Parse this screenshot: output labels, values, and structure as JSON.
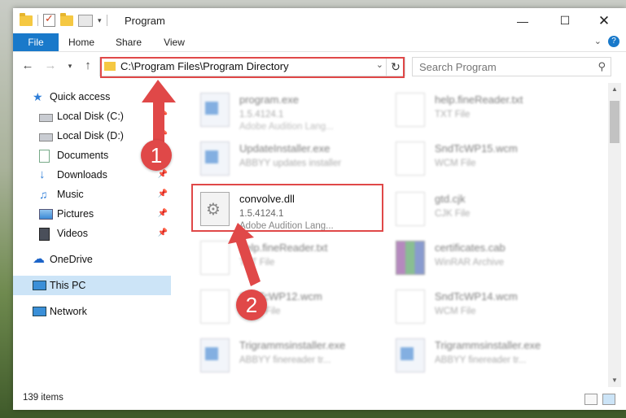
{
  "window": {
    "title": "Program"
  },
  "ribbon": {
    "tabs": [
      "File",
      "Home",
      "Share",
      "View"
    ]
  },
  "nav": {
    "address": "C:\\Program Files\\Program Directory",
    "search_placeholder": "Search Program"
  },
  "sidebar": {
    "items": [
      {
        "label": "Quick access",
        "icon": "star-icon"
      },
      {
        "label": "Local Disk (C:)",
        "icon": "drive-icon",
        "pinned": true
      },
      {
        "label": "Local Disk (D:)",
        "icon": "drive-icon",
        "pinned": true
      },
      {
        "label": "Documents",
        "icon": "documents-icon",
        "pinned": true
      },
      {
        "label": "Downloads",
        "icon": "download-icon",
        "pinned": true
      },
      {
        "label": "Music",
        "icon": "music-icon",
        "pinned": true
      },
      {
        "label": "Pictures",
        "icon": "pictures-icon",
        "pinned": true
      },
      {
        "label": "Videos",
        "icon": "videos-icon",
        "pinned": true
      },
      {
        "label": "OneDrive",
        "icon": "cloud-icon"
      },
      {
        "label": "This PC",
        "icon": "computer-icon",
        "selected": true
      },
      {
        "label": "Network",
        "icon": "network-icon"
      }
    ]
  },
  "files": [
    {
      "name": "program.exe",
      "ver": "1.5.4124.1",
      "type": "Adobe Audition Lang...",
      "icon": "exe",
      "faded": true
    },
    {
      "name": "help.fineReader.txt",
      "ver": "TXT File",
      "type": "",
      "icon": "doc",
      "faded": true
    },
    {
      "name": "UpdateInstaller.exe",
      "ver": "ABBYY updates installer",
      "type": "",
      "icon": "exe",
      "faded": true
    },
    {
      "name": "SndTcWP15.wcm",
      "ver": "WCM File",
      "type": "",
      "icon": "doc",
      "faded": true
    },
    {
      "name": "convolve.dll",
      "ver": "1.5.4124.1",
      "type": "Adobe Audition Lang...",
      "icon": "dll",
      "faded": false
    },
    {
      "name": "gtd.cjk",
      "ver": "CJK File",
      "type": "",
      "icon": "doc",
      "faded": true
    },
    {
      "name": "help.fineReader.txt",
      "ver": "TXT File",
      "type": "",
      "icon": "doc",
      "faded": true
    },
    {
      "name": "certificates.cab",
      "ver": "WinRAR Archive",
      "type": "",
      "icon": "rar",
      "faded": true
    },
    {
      "name": "SndTcWP12.wcm",
      "ver": "WCM File",
      "type": "",
      "icon": "doc",
      "faded": true
    },
    {
      "name": "SndTcWP14.wcm",
      "ver": "WCM File",
      "type": "",
      "icon": "doc",
      "faded": true
    },
    {
      "name": "Trigrammsinstaller.exe",
      "ver": "ABBYY finereader tr...",
      "type": "",
      "icon": "exe",
      "faded": true
    },
    {
      "name": "Trigrammsinstaller.exe",
      "ver": "ABBYY finereader tr...",
      "type": "",
      "icon": "exe",
      "faded": true
    }
  ],
  "status": {
    "item_count": "139 items"
  },
  "annotations": {
    "step1": "1",
    "step2": "2",
    "color": "#e04848"
  }
}
